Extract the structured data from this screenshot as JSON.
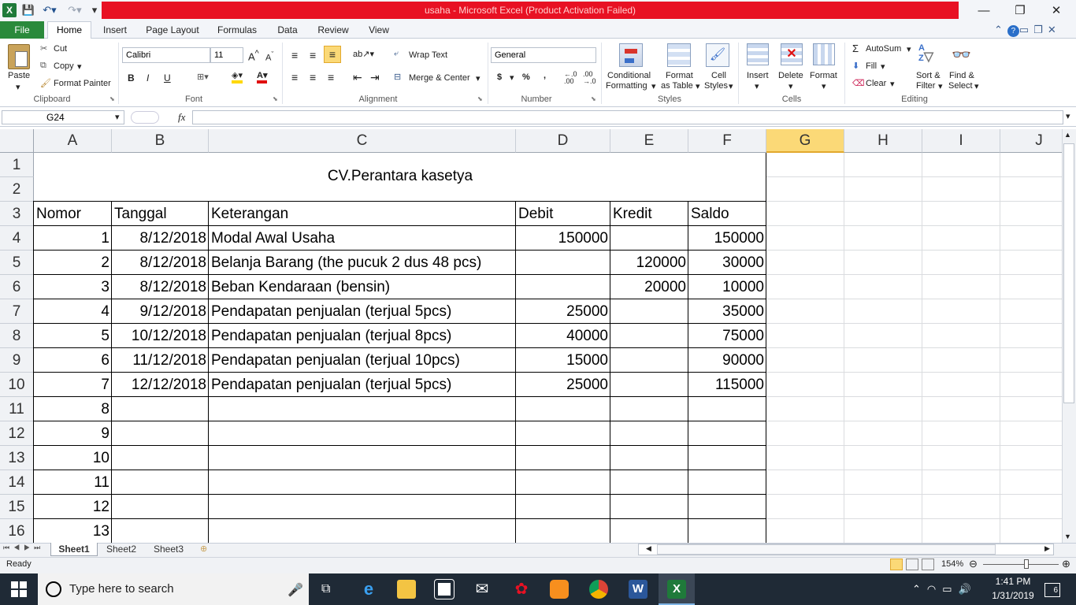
{
  "window": {
    "title": "usaha  -  Microsoft Excel (Product Activation Failed)",
    "minimize": "—",
    "restore": "❐",
    "close": "✕"
  },
  "tabs": [
    "File",
    "Home",
    "Insert",
    "Page Layout",
    "Formulas",
    "Data",
    "Review",
    "View"
  ],
  "ribbon": {
    "clipboard": {
      "paste": "Paste",
      "cut": "Cut",
      "copy": "Copy",
      "format_painter": "Format Painter",
      "label": "Clipboard"
    },
    "font": {
      "name": "Calibri",
      "size": "11",
      "bold": "B",
      "italic": "I",
      "underline": "U",
      "label": "Font"
    },
    "alignment": {
      "wrap": "Wrap Text",
      "merge": "Merge & Center",
      "label": "Alignment"
    },
    "number": {
      "format": "General",
      "currency": "$",
      "percent": "%",
      "comma": ",",
      "label": "Number"
    },
    "styles": {
      "conditional": "Conditional",
      "conditional2": "Formatting",
      "format_table": "Format",
      "format_table2": "as Table",
      "cell_styles": "Cell",
      "cell_styles2": "Styles",
      "label": "Styles"
    },
    "cells": {
      "insert": "Insert",
      "delete": "Delete",
      "format": "Format",
      "label": "Cells"
    },
    "editing": {
      "autosum": "AutoSum",
      "fill": "Fill",
      "clear": "Clear",
      "sort": "Sort &",
      "sort2": "Filter",
      "find": "Find &",
      "find2": "Select",
      "label": "Editing"
    }
  },
  "formula_bar": {
    "name_box": "G24",
    "fx": "fx",
    "value": ""
  },
  "columns": [
    "A",
    "B",
    "C",
    "D",
    "E",
    "F",
    "G",
    "H",
    "I",
    "J"
  ],
  "rows": [
    "1",
    "2",
    "3",
    "4",
    "5",
    "6",
    "7",
    "8",
    "9",
    "10",
    "11",
    "12",
    "13",
    "14",
    "15",
    "16"
  ],
  "sheet": {
    "title": "CV.Perantara kasetya",
    "headers": {
      "a": "Nomor",
      "b": "Tanggal",
      "c": "Keterangan",
      "d": "Debit",
      "e": "Kredit",
      "f": "Saldo"
    },
    "data": [
      {
        "a": "1",
        "b": "8/12/2018",
        "c": "Modal Awal Usaha",
        "d": "150000",
        "e": "",
        "f": "150000"
      },
      {
        "a": "2",
        "b": "8/12/2018",
        "c": "Belanja Barang (the pucuk 2 dus 48 pcs)",
        "d": "",
        "e": "120000",
        "f": "30000"
      },
      {
        "a": "3",
        "b": "8/12/2018",
        "c": "Beban Kendaraan (bensin)",
        "d": "",
        "e": "20000",
        "f": "10000"
      },
      {
        "a": "4",
        "b": "9/12/2018",
        "c": "Pendapatan penjualan (terjual 5pcs)",
        "d": "25000",
        "e": "",
        "f": "35000"
      },
      {
        "a": "5",
        "b": "10/12/2018",
        "c": "Pendapatan penjualan (terjual 8pcs)",
        "d": "40000",
        "e": "",
        "f": "75000"
      },
      {
        "a": "6",
        "b": "11/12/2018",
        "c": "Pendapatan penjualan (terjual 10pcs)",
        "d": "15000",
        "e": "",
        "f": "90000"
      },
      {
        "a": "7",
        "b": "12/12/2018",
        "c": "Pendapatan penjualan (terjual 5pcs)",
        "d": "25000",
        "e": "",
        "f": "115000"
      },
      {
        "a": "8",
        "b": "",
        "c": "",
        "d": "",
        "e": "",
        "f": ""
      },
      {
        "a": "9",
        "b": "",
        "c": "",
        "d": "",
        "e": "",
        "f": ""
      },
      {
        "a": "10",
        "b": "",
        "c": "",
        "d": "",
        "e": "",
        "f": ""
      },
      {
        "a": "11",
        "b": "",
        "c": "",
        "d": "",
        "e": "",
        "f": ""
      },
      {
        "a": "12",
        "b": "",
        "c": "",
        "d": "",
        "e": "",
        "f": ""
      },
      {
        "a": "13",
        "b": "",
        "c": "",
        "d": "",
        "e": "",
        "f": ""
      }
    ]
  },
  "sheet_tabs": [
    "Sheet1",
    "Sheet2",
    "Sheet3"
  ],
  "status": {
    "ready": "Ready",
    "zoom": "154%"
  },
  "taskbar": {
    "search_placeholder": "Type here to search",
    "time": "1:41 PM",
    "date": "1/31/2019",
    "notifications": "6"
  }
}
